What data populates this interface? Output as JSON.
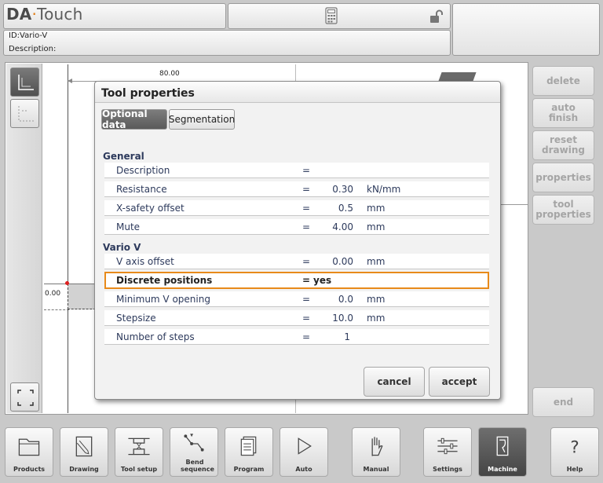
{
  "header": {
    "logo_brand": "DA",
    "logo_dot": "·",
    "logo_suffix": "Touch",
    "id_line": "ID:Vario-V",
    "description_line": "Description:"
  },
  "drawing": {
    "dimension_top": "80.00",
    "dimension_left": "0.00"
  },
  "right_buttons": [
    {
      "label": "delete"
    },
    {
      "label": "auto finish"
    },
    {
      "label": "reset drawing"
    },
    {
      "label": "properties"
    },
    {
      "label": "tool properties"
    },
    {
      "label": "end"
    }
  ],
  "dialog": {
    "title": "Tool properties",
    "tabs": [
      {
        "label": "Optional data",
        "active": true
      },
      {
        "label": "Segmentation",
        "active": false
      }
    ],
    "general_heading": "General",
    "general_rows": [
      {
        "label": "Description",
        "eq": "=",
        "value": "",
        "unit": ""
      },
      {
        "label": "Resistance",
        "eq": "=",
        "value": "0.30",
        "unit": "kN/mm"
      },
      {
        "label": "X-safety offset",
        "eq": "=",
        "value": "0.5",
        "unit": "mm"
      },
      {
        "label": "Mute",
        "eq": "=",
        "value": "4.00",
        "unit": "mm"
      }
    ],
    "vario_heading": "Vario V",
    "vario_rows": [
      {
        "label": "V axis offset",
        "eq": "=",
        "value": "0.00",
        "unit": "mm"
      },
      {
        "label": "Discrete positions",
        "eq": "=",
        "value": "yes",
        "unit": "",
        "selected": true
      },
      {
        "label": "Minimum V opening",
        "eq": "=",
        "value": "0.0",
        "unit": "mm"
      },
      {
        "label": "Stepsize",
        "eq": "=",
        "value": "10.0",
        "unit": "mm"
      },
      {
        "label": "Number of steps",
        "eq": "=",
        "value": "1",
        "unit": ""
      }
    ],
    "cancel_label": "cancel",
    "accept_label": "accept"
  },
  "bottom_nav": [
    {
      "label": "Products",
      "icon": "folder-icon"
    },
    {
      "label": "Drawing",
      "icon": "pencil-icon"
    },
    {
      "label": "Tool setup",
      "icon": "tool-setup-icon"
    },
    {
      "label": "Bend sequence",
      "icon": "bend-sequence-icon"
    },
    {
      "label": "Program",
      "icon": "pages-icon"
    },
    {
      "label": "Auto",
      "icon": "play-icon"
    },
    {
      "label": "Manual",
      "icon": "hand-icon"
    },
    {
      "label": "Settings",
      "icon": "sliders-icon"
    },
    {
      "label": "Machine",
      "icon": "machine-icon",
      "active": true
    },
    {
      "label": "Help",
      "icon": "help-icon"
    }
  ]
}
